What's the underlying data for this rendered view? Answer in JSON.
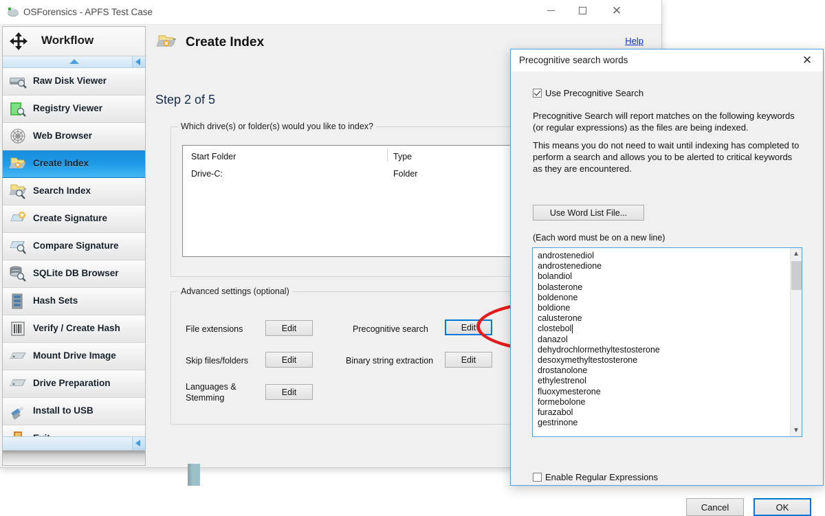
{
  "window": {
    "title": "OSForensics - APFS Test Case",
    "icon": "osforensics-logo-icon",
    "minimize_label": "Minimize",
    "maximize_label": "Maximize",
    "close_label": "Close"
  },
  "sidebar": {
    "header": {
      "label": "Workflow",
      "icon": "workflow-arrows-icon"
    },
    "scroll_up_label": "Scroll up",
    "scroll_down_label": "Scroll down",
    "items": [
      {
        "label": "Raw Disk Viewer",
        "icon": "raw-disk-viewer-icon",
        "selected": false
      },
      {
        "label": "Registry Viewer",
        "icon": "registry-viewer-icon",
        "selected": false
      },
      {
        "label": "Web Browser",
        "icon": "web-browser-icon",
        "selected": false
      },
      {
        "label": "Create Index",
        "icon": "create-index-icon",
        "selected": true
      },
      {
        "label": "Search Index",
        "icon": "search-index-icon",
        "selected": false
      },
      {
        "label": "Create Signature",
        "icon": "create-signature-icon",
        "selected": false
      },
      {
        "label": "Compare Signature",
        "icon": "compare-signature-icon",
        "selected": false
      },
      {
        "label": "SQLite DB Browser",
        "icon": "sqlite-db-browser-icon",
        "selected": false
      },
      {
        "label": "Hash Sets",
        "icon": "hash-sets-icon",
        "selected": false
      },
      {
        "label": "Verify / Create Hash",
        "icon": "verify-create-hash-icon",
        "selected": false
      },
      {
        "label": "Mount Drive Image",
        "icon": "mount-drive-image-icon",
        "selected": false
      },
      {
        "label": "Drive Preparation",
        "icon": "drive-preparation-icon",
        "selected": false
      },
      {
        "label": "Install to USB",
        "icon": "install-to-usb-icon",
        "selected": false
      },
      {
        "label": "Exit",
        "icon": "exit-door-icon",
        "selected": false
      }
    ]
  },
  "content": {
    "title": "Create Index",
    "title_icon": "create-index-icon",
    "help_link": "Help",
    "step": "Step 2 of 5",
    "drives_group": {
      "title": "Which drive(s) or folder(s) would you like to index?",
      "columns": [
        "Start Folder",
        "Type"
      ],
      "rows": [
        {
          "start_folder": "Drive-C:",
          "type": "Folder"
        }
      ]
    },
    "advanced_group": {
      "title": "Advanced settings (optional)",
      "rows_left": [
        {
          "label": "File extensions",
          "button": "Edit",
          "focused": false
        },
        {
          "label": "Skip files/folders",
          "button": "Edit",
          "focused": false
        },
        {
          "label": "Languages &\nStemming",
          "button": "Edit",
          "focused": false
        }
      ],
      "rows_right": [
        {
          "label": "Precognitive search",
          "button": "Edit",
          "focused": true
        },
        {
          "label": "Binary string extraction",
          "button": "Edit",
          "focused": false
        }
      ],
      "labels": {
        "file_extensions": "File extensions",
        "skip_files": "Skip files/folders",
        "languages_line1": "Languages &",
        "languages_line2": "Stemming",
        "precognitive": "Precognitive search",
        "binary_string": "Binary string extraction",
        "edit": "Edit"
      }
    },
    "annotation": {
      "shape": "red-ellipse-highlight",
      "color": "#e61a1a"
    }
  },
  "dialog": {
    "title": "Precognitive search words",
    "close_label": "Close",
    "use_precognitive": {
      "label": "Use Precognitive Search",
      "checked": true
    },
    "paragraph1": "Precognitive Search will report matches on the following keywords (or regular expressions) as the files are being indexed.",
    "paragraph2": "This means you do not need to wait until indexing has completed to perform a search and allows you to be alerted to critical keywords as they are encountered.",
    "word_list_button": "Use Word List File...",
    "newline_note": "(Each word must be on a new line)",
    "words": [
      "androstenediol",
      "androstenedione",
      "bolandiol",
      "bolasterone",
      "boldenone",
      "boldione",
      "calusterone",
      "clostebol",
      "danazol",
      "dehydrochlormethyltestosterone",
      "desoxymethyltestosterone",
      "drostanolone",
      "ethylestrenol",
      "fluoxymesterone",
      "formebolone",
      "furazabol",
      "gestrinone"
    ],
    "caret_after_word": "clostebol",
    "enable_regex": {
      "label": "Enable Regular Expressions",
      "checked": false
    },
    "cancel_label": "Cancel",
    "ok_label": "OK",
    "accent_color": "#0078d7"
  }
}
